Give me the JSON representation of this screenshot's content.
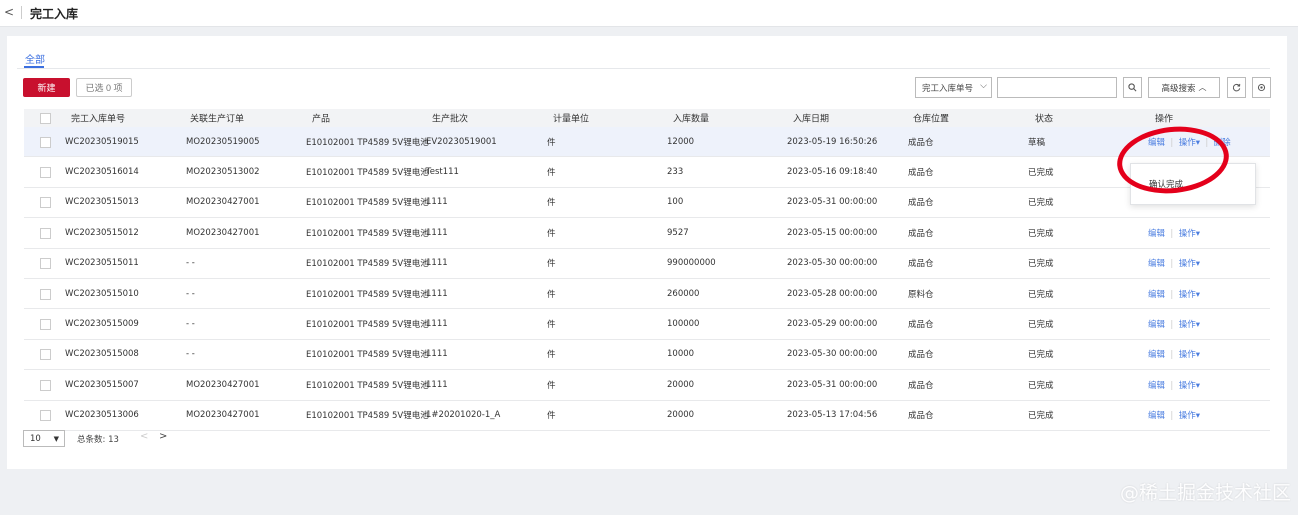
{
  "header": {
    "back_icon": "chevron-left-icon",
    "title": "完工入库"
  },
  "tabs": [
    {
      "label": "全部",
      "active": true
    }
  ],
  "toolbar": {
    "new_label": "新建",
    "selected_label": "已选 0 项"
  },
  "search": {
    "field_label": "完工入库单号",
    "input_value": "",
    "advanced_label": "高级搜索"
  },
  "columns": [
    "完工入库单号",
    "关联生产订单",
    "产品",
    "生产批次",
    "计量单位",
    "入库数量",
    "入库日期",
    "仓库位置",
    "状态",
    "操作"
  ],
  "rows": [
    {
      "id": "WC20230519015",
      "order": "MO20230519005",
      "product": "E10102001 TP4589 5V锂电池",
      "batch": "EV20230519001",
      "unit": "件",
      "qty": "12000",
      "date": "2023-05-19 16:50:26",
      "location": "成品仓",
      "status": "草稿",
      "edit": "编辑",
      "op": "操作▾",
      "del": "删除"
    },
    {
      "id": "WC20230516014",
      "order": "MO20230513002",
      "product": "E10102001 TP4589 5V锂电池",
      "batch": "Test111",
      "unit": "件",
      "qty": "233",
      "date": "2023-05-16 09:18:40",
      "location": "成品仓",
      "status": "已完成",
      "edit": "",
      "op": "",
      "del": ""
    },
    {
      "id": "WC20230515013",
      "order": "MO20230427001",
      "product": "E10102001 TP4589 5V锂电池",
      "batch": "1111",
      "unit": "件",
      "qty": "100",
      "date": "2023-05-31 00:00:00",
      "location": "成品仓",
      "status": "已完成",
      "edit": "",
      "op": "",
      "del": ""
    },
    {
      "id": "WC20230515012",
      "order": "MO20230427001",
      "product": "E10102001 TP4589 5V锂电池",
      "batch": "1111",
      "unit": "件",
      "qty": "9527",
      "date": "2023-05-15 00:00:00",
      "location": "成品仓",
      "status": "已完成",
      "edit": "编辑",
      "op": "操作▾",
      "del": ""
    },
    {
      "id": "WC20230515011",
      "order": "- -",
      "product": "E10102001 TP4589 5V锂电池",
      "batch": "1111",
      "unit": "件",
      "qty": "990000000",
      "date": "2023-05-30 00:00:00",
      "location": "成品仓",
      "status": "已完成",
      "edit": "编辑",
      "op": "操作▾",
      "del": ""
    },
    {
      "id": "WC20230515010",
      "order": "- -",
      "product": "E10102001 TP4589 5V锂电池",
      "batch": "1111",
      "unit": "件",
      "qty": "260000",
      "date": "2023-05-28 00:00:00",
      "location": "原料仓",
      "status": "已完成",
      "edit": "编辑",
      "op": "操作▾",
      "del": ""
    },
    {
      "id": "WC20230515009",
      "order": "- -",
      "product": "E10102001 TP4589 5V锂电池",
      "batch": "1111",
      "unit": "件",
      "qty": "100000",
      "date": "2023-05-29 00:00:00",
      "location": "成品仓",
      "status": "已完成",
      "edit": "编辑",
      "op": "操作▾",
      "del": ""
    },
    {
      "id": "WC20230515008",
      "order": "- -",
      "product": "E10102001 TP4589 5V锂电池",
      "batch": "1111",
      "unit": "件",
      "qty": "10000",
      "date": "2023-05-30 00:00:00",
      "location": "成品仓",
      "status": "已完成",
      "edit": "编辑",
      "op": "操作▾",
      "del": ""
    },
    {
      "id": "WC20230515007",
      "order": "MO20230427001",
      "product": "E10102001 TP4589 5V锂电池",
      "batch": "1111",
      "unit": "件",
      "qty": "20000",
      "date": "2023-05-31 00:00:00",
      "location": "成品仓",
      "status": "已完成",
      "edit": "编辑",
      "op": "操作▾",
      "del": ""
    },
    {
      "id": "WC20230513006",
      "order": "MO20230427001",
      "product": "E10102001 TP4589 5V锂电池",
      "batch": "1#20201020-1_A",
      "unit": "件",
      "qty": "20000",
      "date": "2023-05-13 17:04:56",
      "location": "成品仓",
      "status": "已完成",
      "edit": "编辑",
      "op": "操作▾",
      "del": ""
    }
  ],
  "dropdown": {
    "item": "确认完成"
  },
  "pagination": {
    "page_size": "10",
    "total_label": "总条数: 13"
  },
  "watermark": "@稀土掘金技术社区",
  "colors": {
    "primary": "#c8102e",
    "link": "#4a7de0",
    "annotation": "#e4001b"
  }
}
